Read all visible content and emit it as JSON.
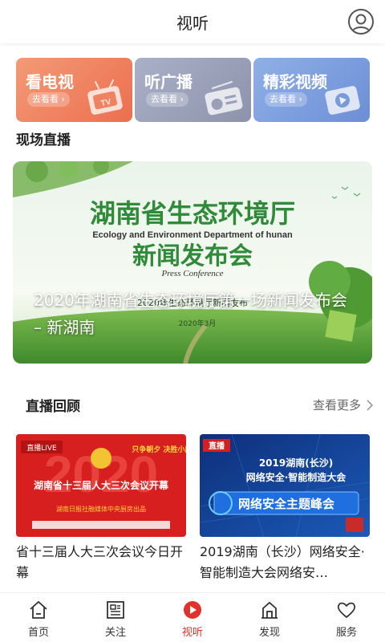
{
  "header": {
    "title": "视听",
    "avatar_icon": "user-icon"
  },
  "categories": [
    {
      "title": "看电视",
      "go": "去看看 ›",
      "icon": "tv-icon"
    },
    {
      "title": "听广播",
      "go": "去看看 ›",
      "icon": "radio-icon"
    },
    {
      "title": "精彩视频",
      "go": "去看看 ›",
      "icon": "video-icon"
    }
  ],
  "live": {
    "section_title": "现场直播",
    "banner": {
      "caption": "2020年湖南省生态环境厅第一场新闻发布会 – 新湖南",
      "poster_title": "湖南省生态环境厅",
      "poster_subtitle_en": "Ecology and Environment Department of hunan",
      "poster_event": "新闻发布会",
      "poster_event_en": "Press Conference",
      "poster_overlay": "2020年生态环境厅新闻发布",
      "poster_date": "2020年3月"
    }
  },
  "replay": {
    "section_title": "直播回顾",
    "more_label": "查看更多",
    "items": [
      {
        "title": "省十三届人大三次会议今日开幕",
        "thumb_badge": "直播LIVE",
        "thumb_big": "2020",
        "thumb_headline": "湖南省十三届人大三次会议开幕",
        "thumb_slogan": "只争朝夕 决胜小康",
        "thumb_footer": "湖南日报社融媒体中央厨房出品"
      },
      {
        "title": "2019湖南（长沙）网络安全·智能制造大会网络安…",
        "thumb_badge": "直播",
        "thumb_line1": "2019湖南(长沙)",
        "thumb_line2": "网络安全·智能制造大会",
        "thumb_line3": "网络安全主题峰会"
      }
    ]
  },
  "tabbar": {
    "items": [
      {
        "label": "首页",
        "icon": "home-icon"
      },
      {
        "label": "关注",
        "icon": "news-icon"
      },
      {
        "label": "视听",
        "icon": "play-icon"
      },
      {
        "label": "发现",
        "icon": "discover-icon"
      },
      {
        "label": "服务",
        "icon": "heart-icon"
      }
    ],
    "active_index": 2
  },
  "colors": {
    "accent": "#e2322b",
    "tv": "#ec6f4f",
    "radio": "#8c93ab",
    "video": "#6d8ed6"
  }
}
